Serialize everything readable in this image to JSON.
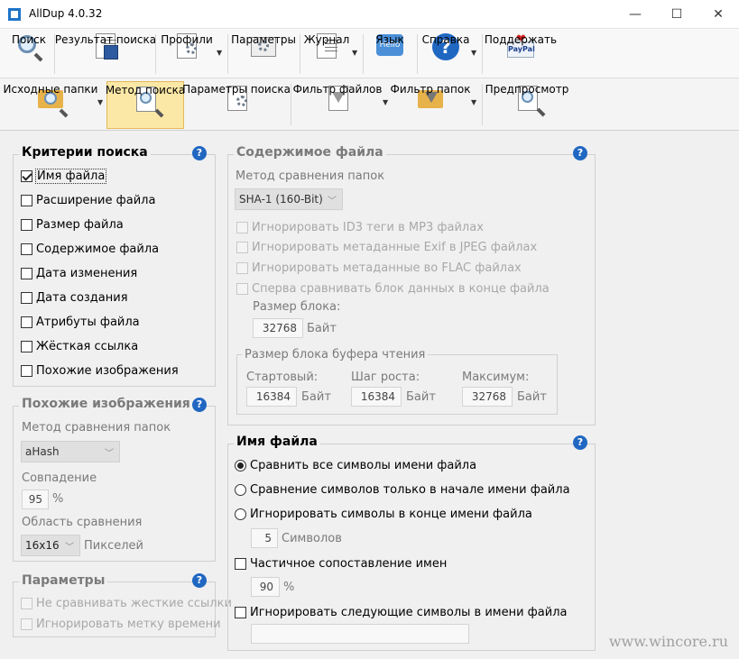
{
  "window": {
    "title": "AllDup 4.0.32",
    "minimize": "—",
    "maximize": "☐",
    "close": "✕"
  },
  "toolbar1": [
    {
      "label": "Поиск",
      "icon": "search-icon"
    },
    {
      "label": "Результат поиска",
      "icon": "save-results-icon"
    },
    {
      "label": "Профили",
      "icon": "profiles-icon"
    },
    {
      "label": "Параметры",
      "icon": "settings-icon"
    },
    {
      "label": "Журнал",
      "icon": "log-icon"
    },
    {
      "label": "Язык",
      "icon": "language-icon",
      "badge": "Hello"
    },
    {
      "label": "Справка",
      "icon": "help-icon",
      "badge": "?"
    },
    {
      "label": "Поддержать",
      "icon": "paypal-icon",
      "badge": "PayPal"
    }
  ],
  "toolbar2": [
    {
      "label": "Исходные папки",
      "icon": "source-folders-icon"
    },
    {
      "label": "Метод поиска",
      "icon": "search-method-icon"
    },
    {
      "label": "Параметры поиска",
      "icon": "search-params-icon"
    },
    {
      "label": "Фильтр файлов",
      "icon": "file-filter-icon"
    },
    {
      "label": "Фильтр папок",
      "icon": "folder-filter-icon"
    },
    {
      "label": "Предпросмотр",
      "icon": "preview-icon"
    }
  ],
  "criteria": {
    "title": "Критерии поиска",
    "items": [
      {
        "label": "Имя файла",
        "checked": true
      },
      {
        "label": "Расширение файла",
        "checked": false
      },
      {
        "label": "Размер файла",
        "checked": false
      },
      {
        "label": "Содержимое файла",
        "checked": false
      },
      {
        "label": "Дата изменения",
        "checked": false
      },
      {
        "label": "Дата создания",
        "checked": false
      },
      {
        "label": "Атрибуты файла",
        "checked": false
      },
      {
        "label": "Жёсткая ссылка",
        "checked": false
      },
      {
        "label": "Похожие изображения",
        "checked": false
      }
    ]
  },
  "similar": {
    "title": "Похожие изображения",
    "method_label": "Метод сравнения папок",
    "method_value": "aHash",
    "match_label": "Совпадение",
    "match_value": "95",
    "match_unit": "%",
    "area_label": "Область сравнения",
    "area_value": "16x16",
    "area_unit": "Пикселей"
  },
  "params": {
    "title": "Параметры",
    "items": [
      {
        "label": "Не сравнивать жесткие ссылки"
      },
      {
        "label": "Игнорировать метку времени"
      }
    ]
  },
  "content": {
    "title": "Содержимое файла",
    "method_label": "Метод сравнения папок",
    "method_value": "SHA-1 (160-Bit)",
    "options": [
      "Игнорировать ID3 теги в MP3 файлах",
      "Игнорировать метаданные Exif в JPEG файлах",
      "Игнорировать метаданные во FLAC файлах",
      "Сперва сравнивать блок данных в конце файла"
    ],
    "block_label": "Размер блока:",
    "block_value": "32768",
    "block_unit": "Байт",
    "buffer": {
      "title": "Размер блока буфера чтения",
      "start_label": "Стартовый:",
      "start_value": "16384",
      "step_label": "Шаг роста:",
      "step_value": "16384",
      "max_label": "Максимум:",
      "max_value": "32768",
      "unit": "Байт"
    }
  },
  "filename": {
    "title": "Имя файла",
    "radios": [
      {
        "label": "Сравнить все символы имени файла",
        "selected": true
      },
      {
        "label": "Сравнение символов только в начале имени файла",
        "selected": false
      },
      {
        "label": "Игнорировать символы в конце имени файла",
        "selected": false
      }
    ],
    "chars_value": "5",
    "chars_unit": "Символов",
    "partial_label": "Частичное сопоставление имен",
    "partial_value": "90",
    "partial_unit": "%",
    "ignore_label": "Игнорировать следующие символы в имени файла",
    "ignore_value": ""
  },
  "watermark": "www.wincore.ru"
}
